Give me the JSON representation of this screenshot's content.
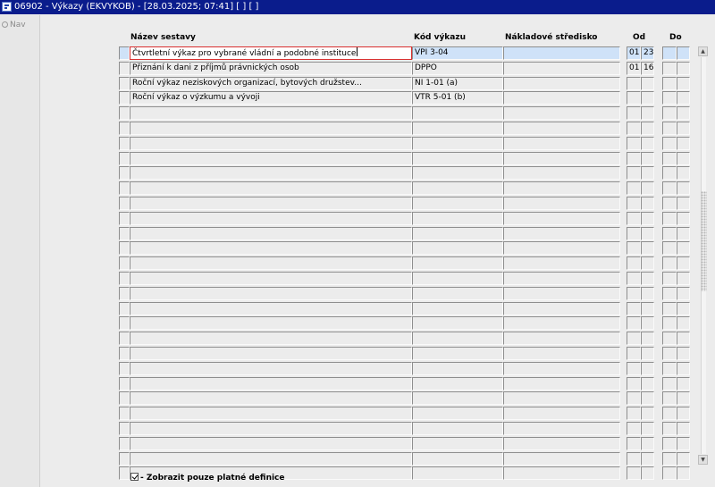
{
  "window": {
    "title": "06902 - Výkazy (EKVYKOB) - [28.03.2025; 07:41]  [ ]  [ ]"
  },
  "nav": {
    "label": "Nav"
  },
  "grid": {
    "columns": {
      "name": "Název sestavy",
      "code": "Kód výkazu",
      "cost_center": "Nákladové středisko",
      "from": "Od",
      "to": "Do"
    },
    "rows": [
      {
        "name": "Čtvrtletní výkaz pro vybrané vládní a podobné instituce",
        "code": "VPI 3-04",
        "cost_center": "",
        "from_a": "01",
        "from_b": "23",
        "to_a": "",
        "to_b": ""
      },
      {
        "name": "Přiznání k dani z příjmů právnických osob",
        "code": "DPPO",
        "cost_center": "",
        "from_a": "01",
        "from_b": "16",
        "to_a": "",
        "to_b": ""
      },
      {
        "name": "Roční výkaz neziskových organizací, bytových družstev...",
        "code": "NI 1-01 (a)",
        "cost_center": "",
        "from_a": "",
        "from_b": "",
        "to_a": "",
        "to_b": ""
      },
      {
        "name": "Roční výkaz o výzkumu a vývoji",
        "code": "VTR 5-01 (b)",
        "cost_center": "",
        "from_a": "",
        "from_b": "",
        "to_a": "",
        "to_b": ""
      },
      {
        "name": "",
        "code": "",
        "cost_center": "",
        "from_a": "",
        "from_b": "",
        "to_a": "",
        "to_b": ""
      },
      {
        "name": "",
        "code": "",
        "cost_center": "",
        "from_a": "",
        "from_b": "",
        "to_a": "",
        "to_b": ""
      },
      {
        "name": "",
        "code": "",
        "cost_center": "",
        "from_a": "",
        "from_b": "",
        "to_a": "",
        "to_b": ""
      },
      {
        "name": "",
        "code": "",
        "cost_center": "",
        "from_a": "",
        "from_b": "",
        "to_a": "",
        "to_b": ""
      },
      {
        "name": "",
        "code": "",
        "cost_center": "",
        "from_a": "",
        "from_b": "",
        "to_a": "",
        "to_b": ""
      },
      {
        "name": "",
        "code": "",
        "cost_center": "",
        "from_a": "",
        "from_b": "",
        "to_a": "",
        "to_b": ""
      },
      {
        "name": "",
        "code": "",
        "cost_center": "",
        "from_a": "",
        "from_b": "",
        "to_a": "",
        "to_b": ""
      },
      {
        "name": "",
        "code": "",
        "cost_center": "",
        "from_a": "",
        "from_b": "",
        "to_a": "",
        "to_b": ""
      },
      {
        "name": "",
        "code": "",
        "cost_center": "",
        "from_a": "",
        "from_b": "",
        "to_a": "",
        "to_b": ""
      },
      {
        "name": "",
        "code": "",
        "cost_center": "",
        "from_a": "",
        "from_b": "",
        "to_a": "",
        "to_b": ""
      },
      {
        "name": "",
        "code": "",
        "cost_center": "",
        "from_a": "",
        "from_b": "",
        "to_a": "",
        "to_b": ""
      },
      {
        "name": "",
        "code": "",
        "cost_center": "",
        "from_a": "",
        "from_b": "",
        "to_a": "",
        "to_b": ""
      },
      {
        "name": "",
        "code": "",
        "cost_center": "",
        "from_a": "",
        "from_b": "",
        "to_a": "",
        "to_b": ""
      },
      {
        "name": "",
        "code": "",
        "cost_center": "",
        "from_a": "",
        "from_b": "",
        "to_a": "",
        "to_b": ""
      },
      {
        "name": "",
        "code": "",
        "cost_center": "",
        "from_a": "",
        "from_b": "",
        "to_a": "",
        "to_b": ""
      },
      {
        "name": "",
        "code": "",
        "cost_center": "",
        "from_a": "",
        "from_b": "",
        "to_a": "",
        "to_b": ""
      },
      {
        "name": "",
        "code": "",
        "cost_center": "",
        "from_a": "",
        "from_b": "",
        "to_a": "",
        "to_b": ""
      },
      {
        "name": "",
        "code": "",
        "cost_center": "",
        "from_a": "",
        "from_b": "",
        "to_a": "",
        "to_b": ""
      },
      {
        "name": "",
        "code": "",
        "cost_center": "",
        "from_a": "",
        "from_b": "",
        "to_a": "",
        "to_b": ""
      },
      {
        "name": "",
        "code": "",
        "cost_center": "",
        "from_a": "",
        "from_b": "",
        "to_a": "",
        "to_b": ""
      },
      {
        "name": "",
        "code": "",
        "cost_center": "",
        "from_a": "",
        "from_b": "",
        "to_a": "",
        "to_b": ""
      },
      {
        "name": "",
        "code": "",
        "cost_center": "",
        "from_a": "",
        "from_b": "",
        "to_a": "",
        "to_b": ""
      },
      {
        "name": "",
        "code": "",
        "cost_center": "",
        "from_a": "",
        "from_b": "",
        "to_a": "",
        "to_b": ""
      },
      {
        "name": "",
        "code": "",
        "cost_center": "",
        "from_a": "",
        "from_b": "",
        "to_a": "",
        "to_b": ""
      },
      {
        "name": "",
        "code": "",
        "cost_center": "",
        "from_a": "",
        "from_b": "",
        "to_a": "",
        "to_b": ""
      }
    ]
  },
  "footer": {
    "checkbox_label": "- Zobrazit pouze platné definice",
    "checked": true
  },
  "scrollbar": {
    "up_icon": "arrow-up-icon",
    "down_icon": "arrow-down-icon"
  },
  "colors": {
    "titlebar": "#0a1c8c",
    "current_row": "#cfe2f8",
    "focus_border": "#d93030"
  }
}
